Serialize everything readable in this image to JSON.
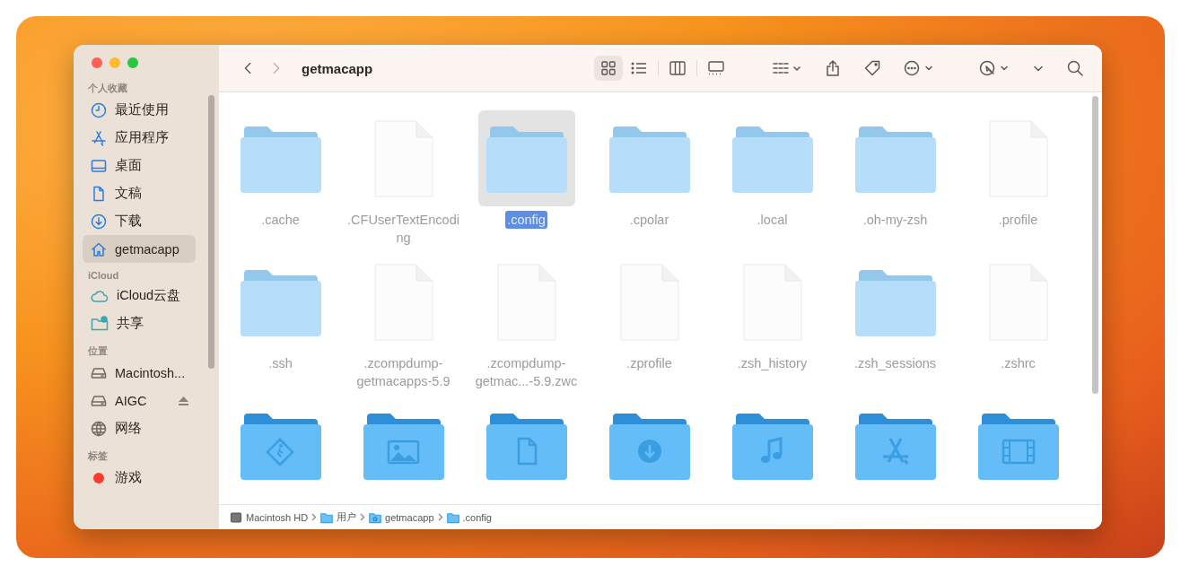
{
  "window": {
    "title": "getmacapp"
  },
  "toolbar": {
    "views": [
      {
        "kind": "icons",
        "selected": true
      },
      {
        "kind": "list",
        "selected": false
      },
      {
        "kind": "columns",
        "selected": false
      },
      {
        "kind": "gallery",
        "selected": false
      }
    ]
  },
  "sidebar": {
    "sections": [
      {
        "title": "个人收藏",
        "items": [
          {
            "label": "最近使用",
            "kind": "clock",
            "selected": false
          },
          {
            "label": "应用程序",
            "kind": "apps",
            "selected": false
          },
          {
            "label": "桌面",
            "kind": "desktop",
            "selected": false
          },
          {
            "label": "文稿",
            "kind": "doc",
            "selected": false
          },
          {
            "label": "下载",
            "kind": "download",
            "selected": false
          },
          {
            "label": "getmacapp",
            "kind": "home",
            "selected": true
          }
        ]
      },
      {
        "title": "iCloud",
        "items": [
          {
            "label": "iCloud云盘",
            "kind": "cloud",
            "selected": false
          },
          {
            "label": "共享",
            "kind": "shared",
            "selected": false
          }
        ]
      },
      {
        "title": "位置",
        "items": [
          {
            "label": "Macintosh...",
            "kind": "drive",
            "selected": false
          },
          {
            "label": "AIGC",
            "kind": "drive",
            "selected": false,
            "eject": true
          },
          {
            "label": "网络",
            "kind": "globe",
            "selected": false
          }
        ]
      },
      {
        "title": "标签",
        "items": [
          {
            "label": "游戏",
            "kind": "tag",
            "color": "#ff3b30",
            "selected": false
          }
        ]
      }
    ]
  },
  "files": [
    {
      "name": ".cache",
      "kind": "folder",
      "dimmed": true,
      "selected": false
    },
    {
      "name": ".CFUserTextEncoding",
      "kind": "document",
      "dimmed": true,
      "selected": false
    },
    {
      "name": ".config",
      "kind": "folder",
      "dimmed": true,
      "selected": true
    },
    {
      "name": ".cpolar",
      "kind": "folder",
      "dimmed": true,
      "selected": false
    },
    {
      "name": ".local",
      "kind": "folder",
      "dimmed": true,
      "selected": false
    },
    {
      "name": ".oh-my-zsh",
      "kind": "folder",
      "dimmed": true,
      "selected": false
    },
    {
      "name": ".profile",
      "kind": "document",
      "dimmed": true,
      "selected": false
    },
    {
      "name": ".ssh",
      "kind": "folder",
      "dimmed": true,
      "selected": false
    },
    {
      "name": ".zcompdump-getmacapps-5.9",
      "kind": "document",
      "dimmed": true,
      "selected": false
    },
    {
      "name": ".zcompdump-getmac...-5.9.zwc",
      "kind": "document",
      "dimmed": true,
      "selected": false
    },
    {
      "name": ".zprofile",
      "kind": "document",
      "dimmed": true,
      "selected": false
    },
    {
      "name": ".zsh_history",
      "kind": "document",
      "dimmed": true,
      "selected": false
    },
    {
      "name": ".zsh_sessions",
      "kind": "folder",
      "dimmed": true,
      "selected": false
    },
    {
      "name": ".zshrc",
      "kind": "document",
      "dimmed": true,
      "selected": false
    },
    {
      "kind": "public",
      "dimmed": false,
      "selected": false
    },
    {
      "kind": "pictures",
      "dimmed": false,
      "selected": false
    },
    {
      "kind": "documents",
      "dimmed": false,
      "selected": false
    },
    {
      "kind": "downloads",
      "dimmed": false,
      "selected": false
    },
    {
      "kind": "music",
      "dimmed": false,
      "selected": false
    },
    {
      "kind": "apps",
      "dimmed": false,
      "selected": false
    },
    {
      "kind": "movies",
      "dimmed": false,
      "selected": false
    }
  ],
  "path_bar": [
    {
      "label": "Macintosh HD",
      "kind": "drive"
    },
    {
      "label": "用户",
      "kind": "folder"
    },
    {
      "label": "getmacapp",
      "kind": "home"
    },
    {
      "label": ".config",
      "kind": "folder"
    }
  ]
}
